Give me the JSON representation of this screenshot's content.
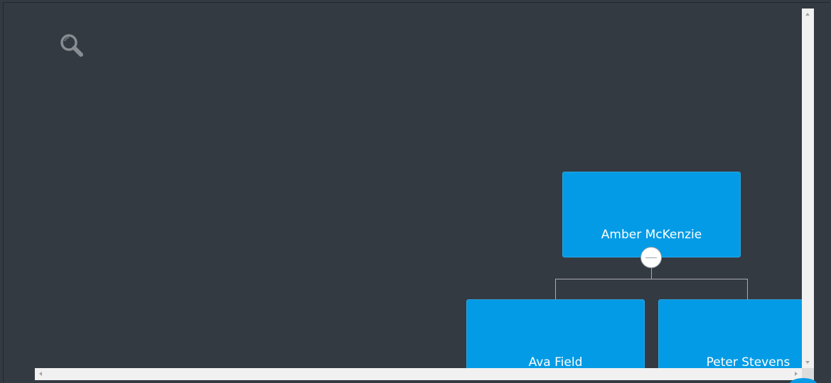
{
  "toolbar": {
    "search_icon": "search-icon"
  },
  "org_chart": {
    "root": {
      "name": "Amber McKenzie",
      "expanded": true
    },
    "children": [
      {
        "name": "Ava Field"
      },
      {
        "name": "Peter Stevens"
      }
    ]
  },
  "colors": {
    "background": "#343a42",
    "node": "#039be5",
    "connector": "#a8adb3",
    "icon": "#888d93"
  }
}
